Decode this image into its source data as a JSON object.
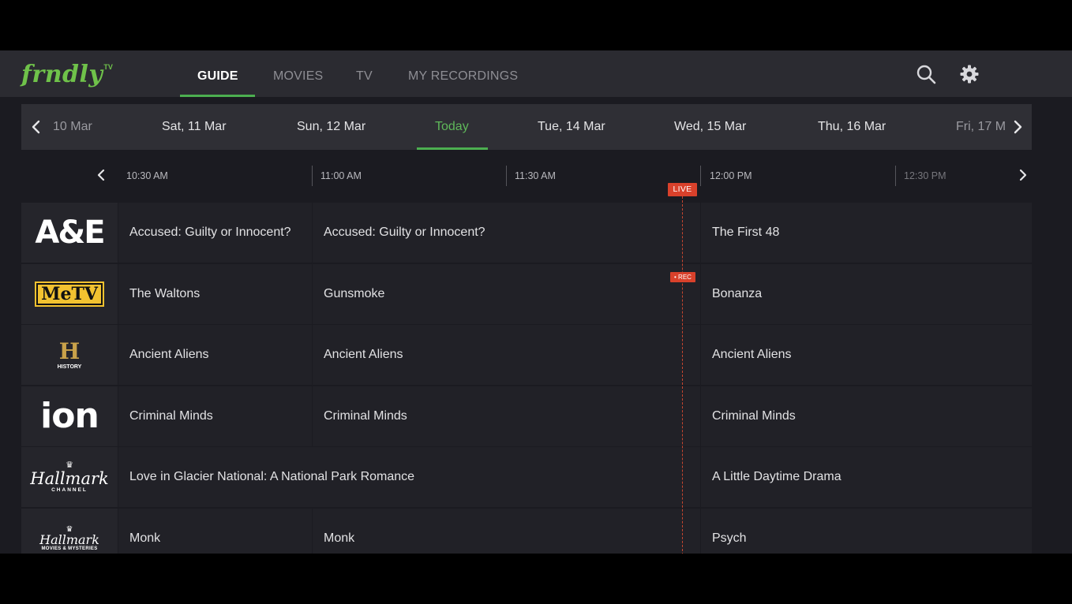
{
  "app": {
    "logo_text": "frndly",
    "logo_suffix": "TV"
  },
  "nav": {
    "items": [
      {
        "label": "GUIDE",
        "active": true
      },
      {
        "label": "MOVIES",
        "active": false
      },
      {
        "label": "TV",
        "active": false
      },
      {
        "label": "MY RECORDINGS",
        "active": false
      }
    ],
    "search_icon": "search-icon",
    "settings_icon": "gear-icon"
  },
  "dates": {
    "items": [
      "10 Mar",
      "Sat, 11 Mar",
      "Sun, 12 Mar",
      "Today",
      "Tue, 14 Mar",
      "Wed, 15 Mar",
      "Thu, 16 Mar",
      "Fri, 17 M"
    ],
    "selected": "Today"
  },
  "times": {
    "ticks": [
      "10:30 AM",
      "11:00 AM",
      "11:30 AM",
      "12:00 PM",
      "12:30 PM"
    ]
  },
  "live_badge": "LIVE",
  "rec_badge": "• REC",
  "channels": [
    {
      "logo": "A&E",
      "programs": [
        "Accused: Guilty or Innocent?",
        "Accused: Guilty or Innocent?",
        "The First 48"
      ]
    },
    {
      "logo": "MeTV",
      "programs": [
        "The Waltons",
        "Gunsmoke",
        "Bonanza"
      ]
    },
    {
      "logo": "HISTORY",
      "programs": [
        "Ancient Aliens",
        "Ancient Aliens",
        "Ancient Aliens"
      ]
    },
    {
      "logo": "ion",
      "programs": [
        "Criminal Minds",
        "Criminal Minds",
        "Criminal Minds"
      ]
    },
    {
      "logo": "Hallmark",
      "logo_sub": "CHANNEL",
      "programs": [
        "Love in Glacier National: A National Park Romance",
        "A Little Daytime Drama"
      ]
    },
    {
      "logo": "Hallmark",
      "logo_sub": "MOVIES & MYSTERIES",
      "programs": [
        "Monk",
        "Monk",
        "Psych"
      ]
    }
  ],
  "colors": {
    "accent_green": "#4caf50",
    "live_red": "#d9412b",
    "metv_yellow": "#f2c230"
  }
}
